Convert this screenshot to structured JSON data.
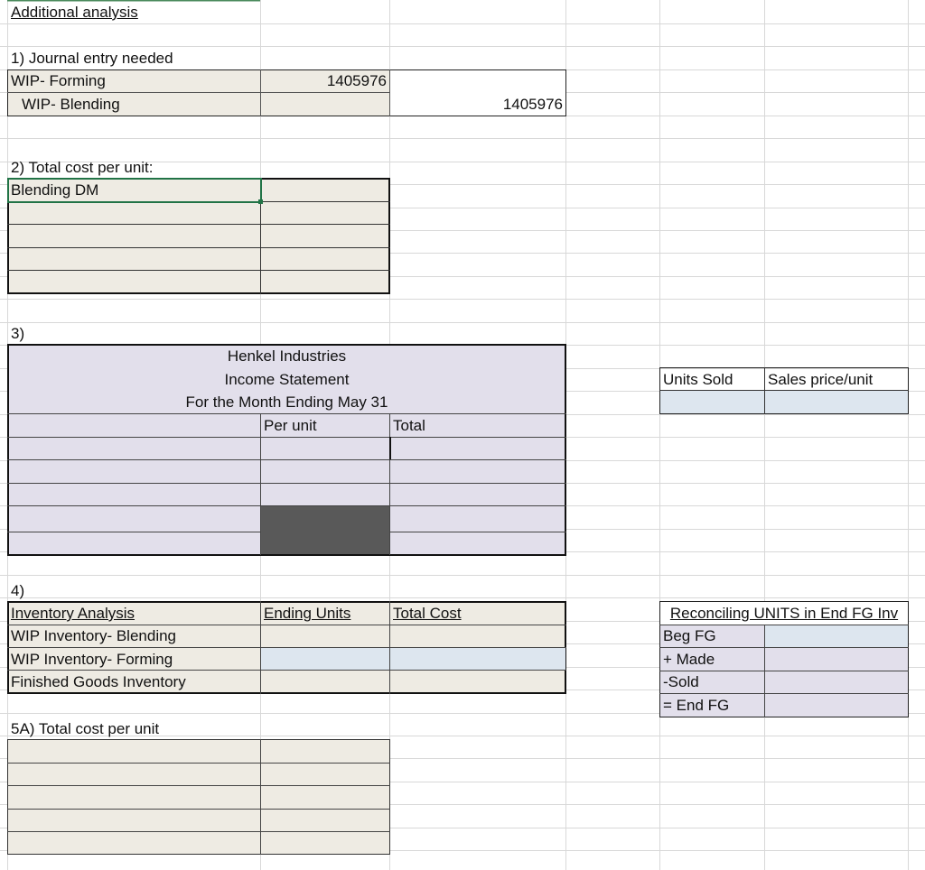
{
  "sheet": {
    "title": "Additional analysis",
    "q1": {
      "heading": "1) Journal entry needed",
      "debit_account": "WIP- Forming",
      "debit_amount": "1405976",
      "credit_account": "WIP- Blending",
      "credit_amount": "1405976"
    },
    "q2": {
      "heading": "2) Total cost per unit:",
      "first_row": "Blending DM"
    },
    "q3": {
      "heading": "3)",
      "company": "Henkel Industries",
      "statement": "Income Statement",
      "period": "For the Month Ending May 31",
      "col_per_unit": "Per unit",
      "col_total": "Total",
      "units_sold_label": "Units Sold",
      "sales_price_label": "Sales price/unit"
    },
    "q4": {
      "heading": "4)",
      "table_title": "Inventory Analysis",
      "col_ending_units": "Ending Units",
      "col_total_cost": "Total Cost",
      "rows": [
        "WIP Inventory- Blending",
        "WIP Inventory- Forming",
        "Finished Goods Inventory"
      ],
      "reconcile_title": "Reconciling UNITS in End FG Inv",
      "reconcile_rows": [
        "Beg FG",
        "+ Made",
        "-Sold",
        "= End FG"
      ]
    },
    "q5a": {
      "heading": "5A) Total cost per unit"
    }
  },
  "colors": {
    "beige": "#eeebe3",
    "lavender": "#e2dfeb",
    "light_blue": "#dde6ef",
    "dark_gray": "#595959",
    "selection": "#217346"
  }
}
